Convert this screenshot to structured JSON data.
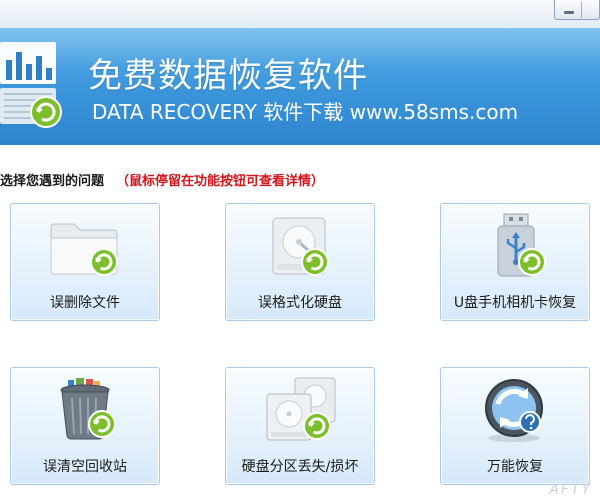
{
  "banner": {
    "title": "免费数据恢复软件",
    "subtitle": "DATA RECOVERY  软件下载  www.58sms.com"
  },
  "prompt": {
    "label": "选择您遇到的问题",
    "hint": "（鼠标停留在功能按钮可查看详情）"
  },
  "features": [
    {
      "label": "误删除文件",
      "icon": "folder-recover-icon"
    },
    {
      "label": "误格式化硬盘",
      "icon": "hard-disk-recover-icon"
    },
    {
      "label": "U盘手机相机卡恢复",
      "icon": "usb-drive-recover-icon"
    },
    {
      "label": "误清空回收站",
      "icon": "recycle-bin-recover-icon"
    },
    {
      "label": "硬盘分区丢失/损坏",
      "icon": "partition-recover-icon"
    },
    {
      "label": "万能恢复",
      "icon": "universal-recover-icon"
    }
  ],
  "watermark": "AFTY",
  "colors": {
    "banner": "#3b95db",
    "hint": "#d2161e",
    "button_border": "#a9cbe9",
    "recover_badge": "#7cbf2b"
  }
}
